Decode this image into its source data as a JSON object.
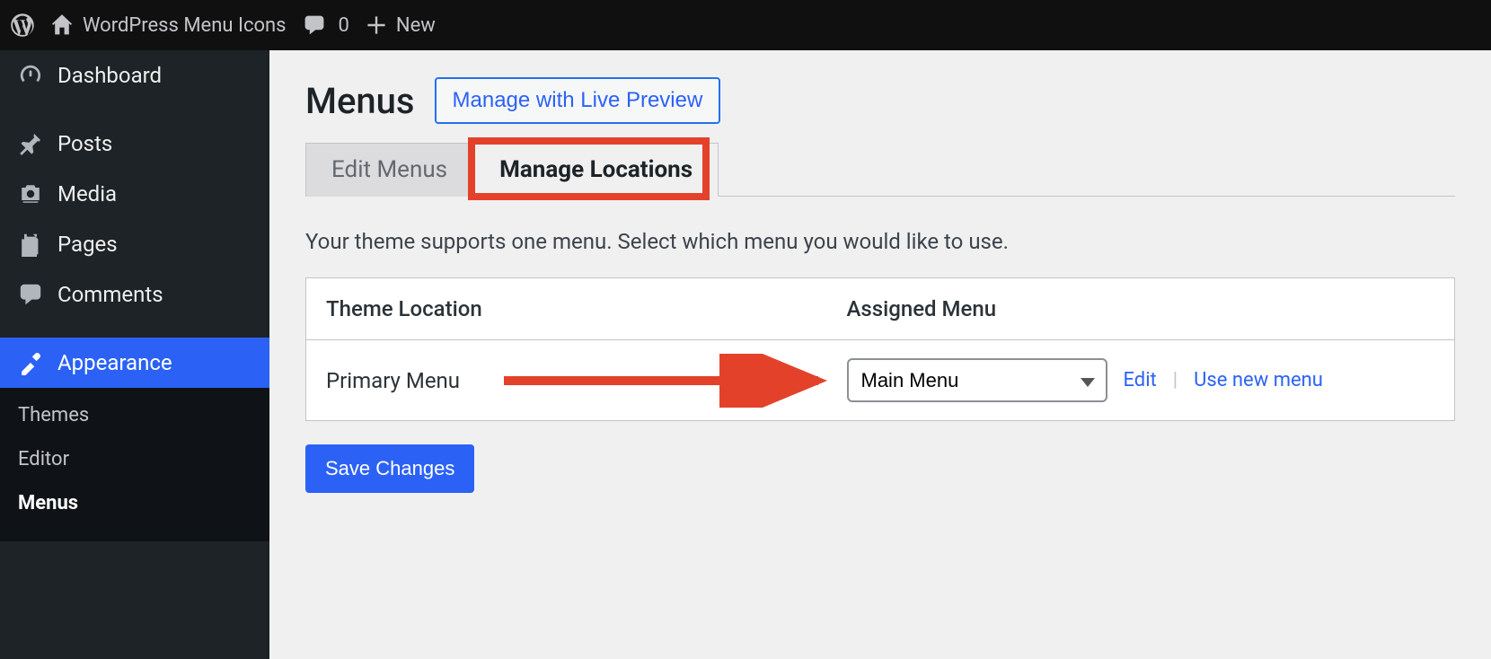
{
  "adminbar": {
    "site_title": "WordPress Menu Icons",
    "comments_count": "0",
    "new_label": "New"
  },
  "sidebar": {
    "items": [
      {
        "label": "Dashboard"
      },
      {
        "label": "Posts"
      },
      {
        "label": "Media"
      },
      {
        "label": "Pages"
      },
      {
        "label": "Comments"
      },
      {
        "label": "Appearance"
      }
    ],
    "appearance_submenu": {
      "themes": "Themes",
      "editor": "Editor",
      "menus": "Menus"
    }
  },
  "page": {
    "title": "Menus",
    "live_preview_btn": "Manage with Live Preview",
    "tabs": {
      "edit": "Edit Menus",
      "manage": "Manage Locations"
    },
    "helper": "Your theme supports one menu. Select which menu you would like to use.",
    "table": {
      "col_location": "Theme Location",
      "col_assigned": "Assigned Menu",
      "row_label": "Primary Menu",
      "selected_menu": "Main Menu",
      "edit_link": "Edit",
      "new_link": "Use new menu"
    },
    "save_btn": "Save Changes"
  },
  "annotations": {
    "highlight_color": "#e4412b"
  }
}
